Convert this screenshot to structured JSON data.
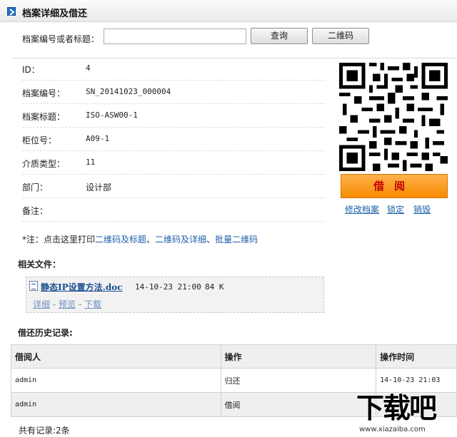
{
  "header": {
    "title": "档案详细及借还"
  },
  "search": {
    "label": "档案编号或者标题：",
    "value": "",
    "placeholder": "",
    "query_button": "查询",
    "qr_button": "二维码"
  },
  "info": [
    {
      "label": "ID：",
      "value": "4"
    },
    {
      "label": "档案编号：",
      "value": "SN_20141023_000004"
    },
    {
      "label": "档案标题：",
      "value": "ISO-ASW00-1"
    },
    {
      "label": "柜位号：",
      "value": "A09-1"
    },
    {
      "label": "介质类型：",
      "value": "11"
    },
    {
      "label": "部门：",
      "value": "设计部"
    },
    {
      "label": "备注：",
      "value": ""
    }
  ],
  "actions": {
    "borrow": "借阅",
    "edit": "修改档案",
    "lock": "锁定",
    "destroy": "销毁"
  },
  "note": {
    "prefix": "*注：点击这里打印",
    "link1": "二维码及标题",
    "sep1": "、",
    "link2": "二维码及详细",
    "sep2": "、",
    "link3": "批量二维码"
  },
  "files": {
    "section_title": "相关文件：",
    "items": [
      {
        "name": "静态IP设置方法.doc",
        "date": "14-10-23 21:00",
        "size": "84 K",
        "detail": "详细",
        "preview": "预览",
        "download": "下载",
        "sep": "-"
      }
    ]
  },
  "history": {
    "section_title": "借还历史记录:",
    "columns": [
      "借阅人",
      "操作",
      "操作时间"
    ],
    "rows": [
      {
        "user": "admin",
        "action": "归还",
        "time": "14-10-23 21:03"
      },
      {
        "user": "admin",
        "action": "借阅",
        "time": ""
      }
    ],
    "total": "共有记录:2条"
  },
  "watermark": {
    "text": "下载吧",
    "url": "www.xiazaiba.com"
  }
}
